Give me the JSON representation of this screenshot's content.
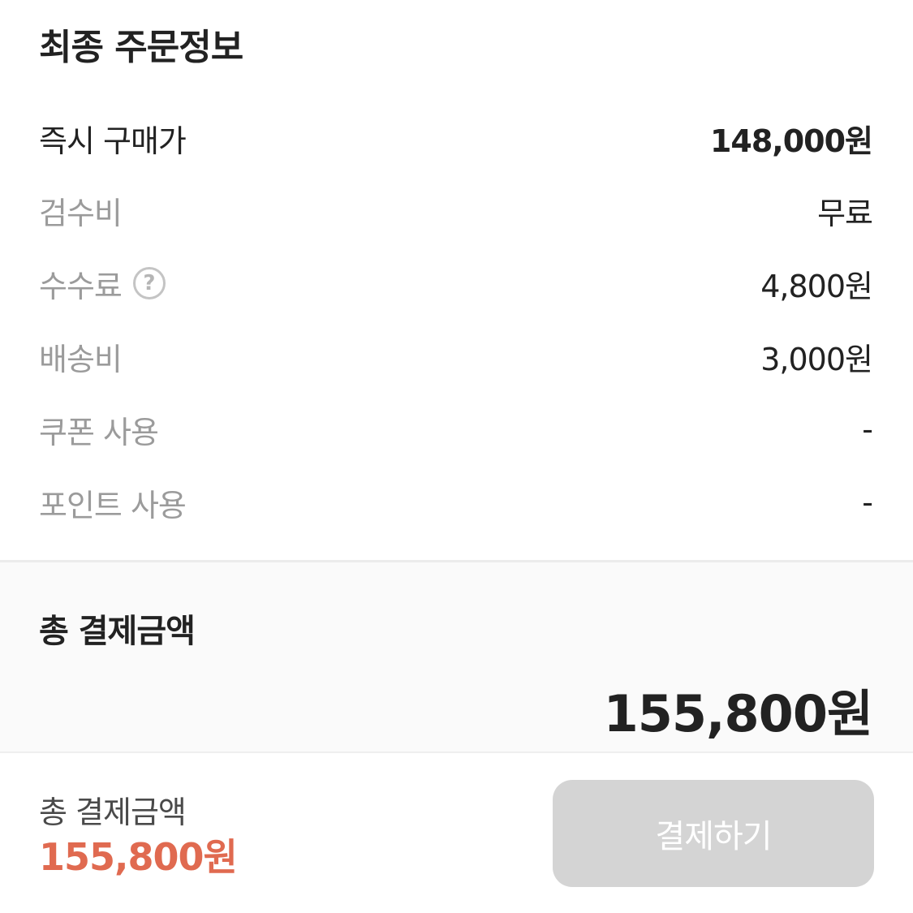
{
  "order_info": {
    "title": "최종 주문정보",
    "rows": [
      {
        "label": "즉시 구매가",
        "value": "148,000원"
      },
      {
        "label": "검수비",
        "value": "무료"
      },
      {
        "label": "수수료",
        "value": "4,800원",
        "help_icon": "question-circle-icon"
      },
      {
        "label": "배송비",
        "value": "3,000원"
      },
      {
        "label": "쿠폰 사용",
        "value": "-"
      },
      {
        "label": "포인트 사용",
        "value": "-"
      }
    ]
  },
  "total": {
    "label": "총 결제금액",
    "amount": "155,800원"
  },
  "bottom_bar": {
    "label": "총 결제금액",
    "amount": "155,800원",
    "pay_button_label": "결제하기",
    "pay_button_disabled": true
  },
  "colors": {
    "accent": "#e06a50",
    "disabled_button": "#d4d4d4",
    "muted_text": "#9b9b9b"
  }
}
